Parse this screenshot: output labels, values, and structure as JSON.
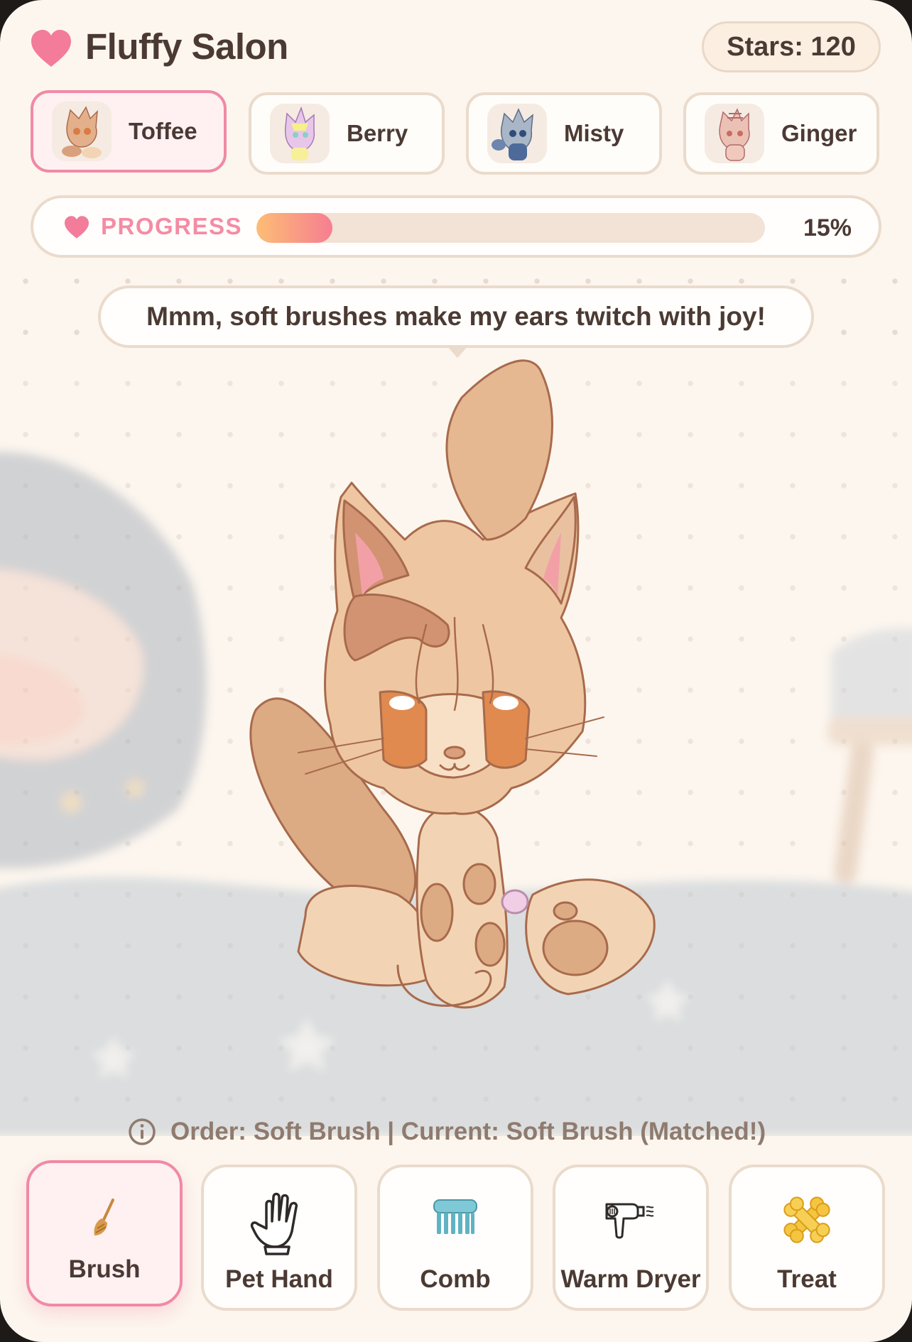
{
  "header": {
    "title": "Fluffy Salon",
    "stars_text": "Stars: 120"
  },
  "pets": [
    {
      "name": "Toffee",
      "active": true
    },
    {
      "name": "Berry",
      "active": false
    },
    {
      "name": "Misty",
      "active": false
    },
    {
      "name": "Ginger",
      "active": false
    }
  ],
  "progress": {
    "label": "PROGRESS",
    "value": 0.15,
    "percent_text": "15%"
  },
  "speech": {
    "text": "Mmm, soft brushes make my ears twitch with joy!"
  },
  "order": {
    "icon": "info-icon",
    "text": "Order: Soft Brush | Current: Soft Brush (Matched!)"
  },
  "tools": [
    {
      "label": "Brush",
      "icon": "brush-icon",
      "active": true
    },
    {
      "label": "Pet Hand",
      "icon": "hand-icon",
      "active": false
    },
    {
      "label": "Comb",
      "icon": "comb-icon",
      "active": false
    },
    {
      "label": "Warm Dryer",
      "icon": "dryer-icon",
      "active": false
    },
    {
      "label": "Treat",
      "icon": "treat-icon",
      "active": false
    }
  ],
  "colors": {
    "accent_pink": "#f08aa4",
    "background": "#fdf6ef",
    "text": "#4b3a33"
  }
}
